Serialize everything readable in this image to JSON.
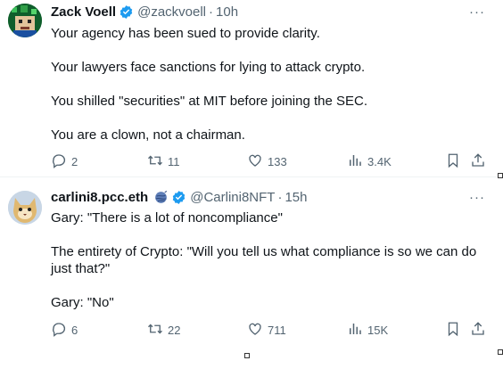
{
  "tweets": [
    {
      "name": "Zack Voell",
      "handle": "@zackvoell",
      "time": "10h",
      "paragraphs": [
        "Your agency has been sued to provide clarity.",
        "Your lawyers face sanctions for lying to attack crypto.",
        "You shilled \"securities\" at MIT before joining the SEC.",
        "You are a clown, not a chairman."
      ],
      "replies": "2",
      "reposts": "11",
      "likes": "133",
      "views": "3.4K"
    },
    {
      "name": "carlini8.pcc.eth",
      "handle": "@Carlini8NFT",
      "time": "15h",
      "paragraphs": [
        "Gary: \"There is a lot of noncompliance\"",
        "The entirety of Crypto: \"Will you tell us what compliance is so we can do just that?\"",
        "Gary: \"No\""
      ],
      "replies": "6",
      "reposts": "22",
      "likes": "711",
      "views": "15K"
    }
  ],
  "icons": {
    "verified": "verified-badge-icon",
    "reply": "reply-icon",
    "repost": "repost-icon",
    "like": "heart-icon",
    "views": "views-icon",
    "bookmark": "bookmark-icon",
    "share": "share-icon",
    "more": "more-icon"
  },
  "colors": {
    "verified": "#1d9bf0",
    "muted": "#536471",
    "text": "#0f1419"
  },
  "more_label": "···"
}
